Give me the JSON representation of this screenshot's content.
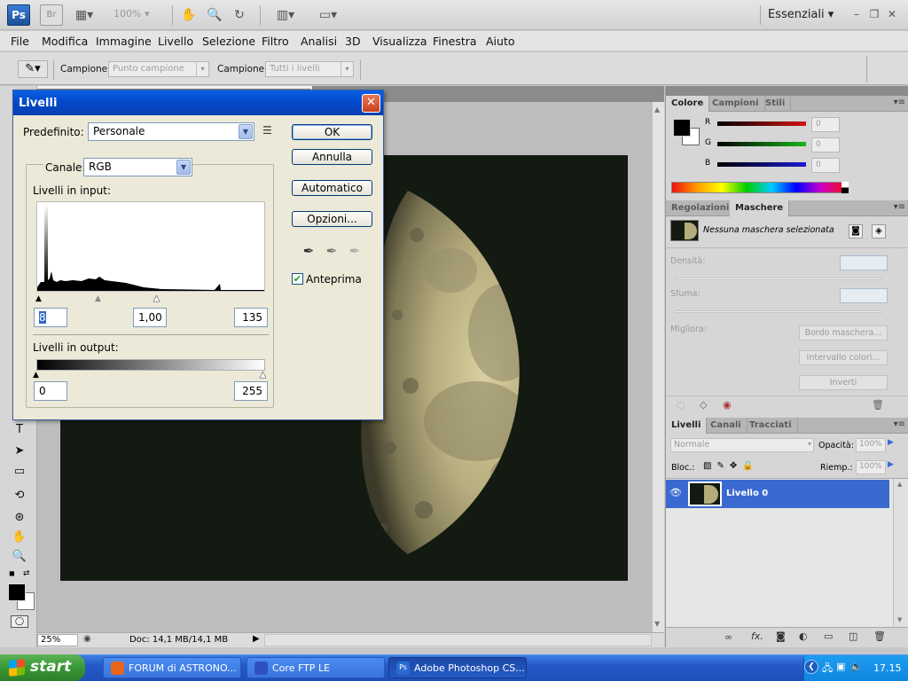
{
  "app": {
    "logo": "Ps",
    "bridge": "Br",
    "zoom": "100%",
    "workspace": "Essenziali",
    "window_controls": [
      "–",
      "❐",
      "✕"
    ]
  },
  "menu": [
    "File",
    "Modifica",
    "Immagine",
    "Livello",
    "Selezione",
    "Filtro",
    "Analisi",
    "3D",
    "Visualizza",
    "Finestra",
    "Aiuto"
  ],
  "options_bar": {
    "sample_label": "Campione:",
    "sample_value": "Punto campione",
    "sample2_label": "Campione:",
    "sample2_value": "Tutti i livelli"
  },
  "status_bar": {
    "zoom": "25%",
    "doc": "Doc: 14,1 MB/14,1 MB"
  },
  "color_panel": {
    "tabs": [
      "Colore",
      "Campioni",
      "Stili"
    ],
    "channels": [
      {
        "label": "R",
        "value": "0",
        "color": "#d21414"
      },
      {
        "label": "G",
        "value": "0",
        "color": "#19b419"
      },
      {
        "label": "B",
        "value": "0",
        "color": "#1a1ad2"
      }
    ]
  },
  "masks_panel": {
    "tabs": [
      "Regolazioni",
      "Maschere"
    ],
    "status": "Nessuna maschera selezionata",
    "density_label": "Densità:",
    "feather_label": "Sfuma:",
    "refine_label": "Migliora:",
    "mask_edge": "Bordo maschera...",
    "color_range": "Intervallo colori...",
    "invert": "Inverti"
  },
  "layers_panel": {
    "tabs": [
      "Livelli",
      "Canali",
      "Tracciati"
    ],
    "blend_mode": "Normale",
    "opacity_label": "Opacità:",
    "opacity": "100%",
    "lock_label": "Bloc.:",
    "fill_label": "Riemp.:",
    "fill": "100%",
    "layer_name": "Livello 0"
  },
  "dialog": {
    "title": "Livelli",
    "preset_label": "Predefinito:",
    "preset": "Personale",
    "channel_label": "Canale:",
    "channel": "RGB",
    "input_label": "Livelli in input:",
    "input_black": "8",
    "input_gamma": "1,00",
    "input_white": "135",
    "output_label": "Livelli in output:",
    "output_black": "0",
    "output_white": "255",
    "ok": "OK",
    "cancel": "Annulla",
    "auto": "Automatico",
    "options": "Opzioni...",
    "preview_label": "Anteprima",
    "preview_checked": true
  },
  "taskbar": {
    "start": "start",
    "items": [
      {
        "label": "FORUM di ASTRONO...",
        "active": false,
        "icon_color": "#e8661a"
      },
      {
        "label": "Core FTP LE",
        "active": false,
        "icon_color": "#3050c0"
      },
      {
        "label": "Adobe Photoshop CS...",
        "active": true,
        "icon_color": "#2a6ad0"
      }
    ],
    "clock": "17.15"
  }
}
